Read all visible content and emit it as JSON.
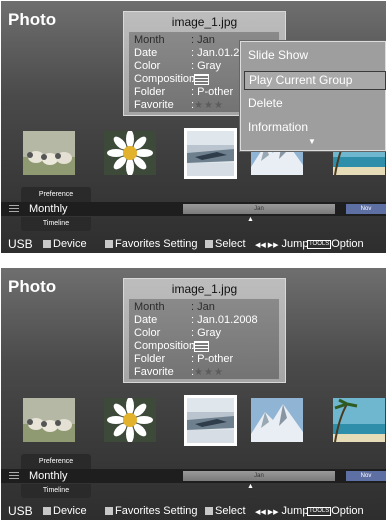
{
  "screens": [
    {
      "title": "Photo",
      "info": {
        "filename": "image_1.jpg",
        "rows": [
          {
            "label": "Month",
            "value": ": Jan",
            "highlight": true
          },
          {
            "label": "Date",
            "value": ": Jan.01.2",
            "highlight": false
          },
          {
            "label": "Color",
            "value": ": Gray",
            "highlight": false
          },
          {
            "label": "Composition",
            "value": ":",
            "highlight": false
          },
          {
            "label": "Folder",
            "value": ": P-other",
            "highlight": false
          },
          {
            "label": "Favorite",
            "value": ":",
            "highlight": false
          }
        ],
        "favorite_stars": "★★★",
        "composition_icon": "composition-lines-icon"
      },
      "menu": {
        "items": [
          "Slide Show",
          "Play Current Group",
          "Delete",
          "Information"
        ],
        "focused_index": 1,
        "more_arrow": "▼"
      },
      "timeline": {
        "preference": "Preference",
        "sort": "Monthly",
        "label": "Timeline",
        "current": "Jan",
        "next": "Nov"
      },
      "footer": {
        "source": "USB",
        "device": "Device",
        "favorites": "Favorites Setting",
        "select": "Select",
        "jump_icon": "◀◀ ▶▶",
        "jump": "Jump",
        "tools": "TOOLS",
        "option": "Option"
      }
    },
    {
      "title": "Photo",
      "info": {
        "filename": "image_1.jpg",
        "rows": [
          {
            "label": "Month",
            "value": ": Jan",
            "highlight": true
          },
          {
            "label": "Date",
            "value": ": Jan.01.2008",
            "highlight": false
          },
          {
            "label": "Color",
            "value": ": Gray",
            "highlight": false
          },
          {
            "label": "Composition",
            "value": ":",
            "highlight": false
          },
          {
            "label": "Folder",
            "value": ": P-other",
            "highlight": false
          },
          {
            "label": "Favorite",
            "value": ":",
            "highlight": false
          }
        ],
        "favorite_stars": "★★★",
        "composition_icon": "composition-lines-icon"
      },
      "timeline": {
        "preference": "Preference",
        "sort": "Monthly",
        "label": "Timeline",
        "current": "Jan",
        "next": "Nov"
      },
      "footer": {
        "source": "USB",
        "device": "Device",
        "favorites": "Favorites Setting",
        "select": "Select",
        "jump_icon": "◀◀ ▶▶",
        "jump": "Jump",
        "tools": "TOOLS",
        "option": "Option"
      }
    }
  ],
  "thumbnails": [
    {
      "name": "thumb-sheep",
      "selected": false
    },
    {
      "name": "thumb-flower",
      "selected": false
    },
    {
      "name": "thumb-seascape",
      "selected": true
    },
    {
      "name": "thumb-mountain",
      "selected": false
    },
    {
      "name": "thumb-beach",
      "selected": false
    }
  ],
  "colors": {
    "panel_bg": "#4a4a4a",
    "menu_bg": "#9e9e9e",
    "info_bg": "#b0b0b0",
    "nov_tag": "#5e6fa4",
    "text": "#ffffff"
  }
}
